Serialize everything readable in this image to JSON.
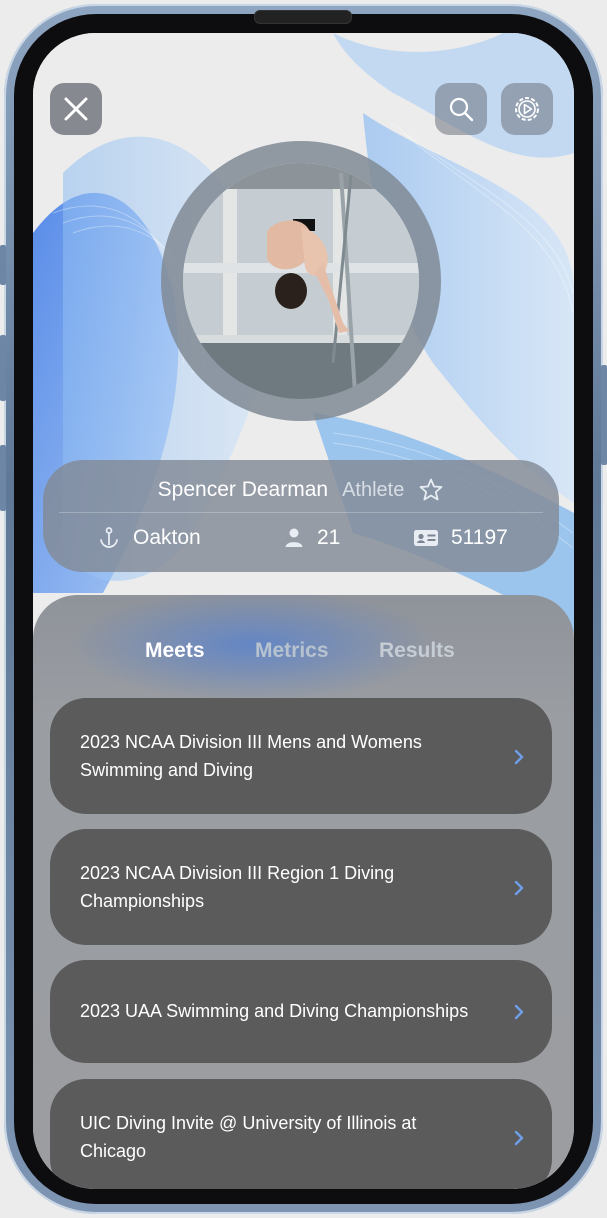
{
  "header": {
    "close_icon": "close-icon",
    "search_icon": "search-icon",
    "settings_icon": "settings-icon"
  },
  "profile": {
    "name": "Spencer Dearman",
    "role": "Athlete",
    "favorite_icon": "star-outline-icon",
    "stats": {
      "team": {
        "icon": "anchor-icon",
        "value": "Oakton"
      },
      "age": {
        "icon": "person-icon",
        "value": "21"
      },
      "id": {
        "icon": "id-card-icon",
        "value": "51197"
      }
    }
  },
  "tabs": [
    {
      "label": "Meets",
      "active": true
    },
    {
      "label": "Metrics",
      "active": false
    },
    {
      "label": "Results",
      "active": false
    }
  ],
  "meets": [
    {
      "line1": "2023 NCAA Division III Mens and Womens",
      "line2": "Swimming and Diving"
    },
    {
      "line1": "2023 NCAA Division III Region 1 Diving",
      "line2": "Championships"
    },
    {
      "line1": "2023 UAA Swimming and Diving Championships",
      "line2": ""
    },
    {
      "line1": "UIC Diving Invite @ University of Illinois at",
      "line2": "Chicago"
    }
  ],
  "colors": {
    "accent": "#6f9ee8",
    "card": "#5b5b5c",
    "info_card": "#828a96"
  }
}
